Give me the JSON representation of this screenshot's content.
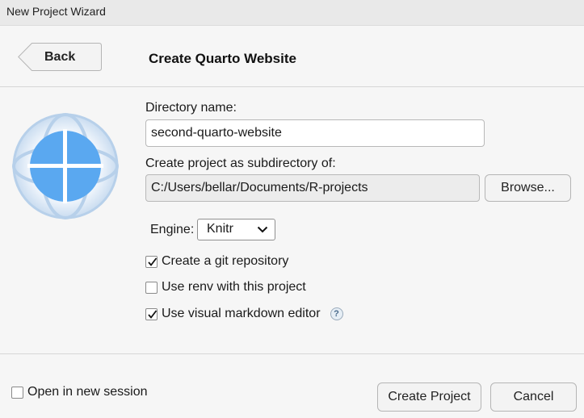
{
  "window": {
    "title": "New Project Wizard"
  },
  "header": {
    "back_label": "Back",
    "page_title": "Create Quarto Website"
  },
  "form": {
    "directory_name_label": "Directory name:",
    "directory_name_value": "second-quarto-website",
    "subdirectory_label": "Create project as subdirectory of:",
    "subdirectory_value": "C:/Users/bellar/Documents/R-projects",
    "browse_label": "Browse...",
    "engine_label": "Engine:",
    "engine_value": "Knitr",
    "options": [
      {
        "label": "Create a git repository",
        "checked": true
      },
      {
        "label": "Use renv with this project",
        "checked": false
      },
      {
        "label": "Use visual markdown editor",
        "checked": true
      }
    ],
    "help_symbol": "?"
  },
  "footer": {
    "open_new_session_label": "Open in new session",
    "open_new_session_checked": false,
    "create_label": "Create Project",
    "cancel_label": "Cancel"
  },
  "icons": {
    "logo": "quarto-globe-icon",
    "check": "check-icon",
    "dropdown": "chevron-down-icon",
    "help": "help-icon"
  },
  "colors": {
    "logo_blue": "#5aa8f0",
    "logo_ring": "#b7d0ea"
  }
}
